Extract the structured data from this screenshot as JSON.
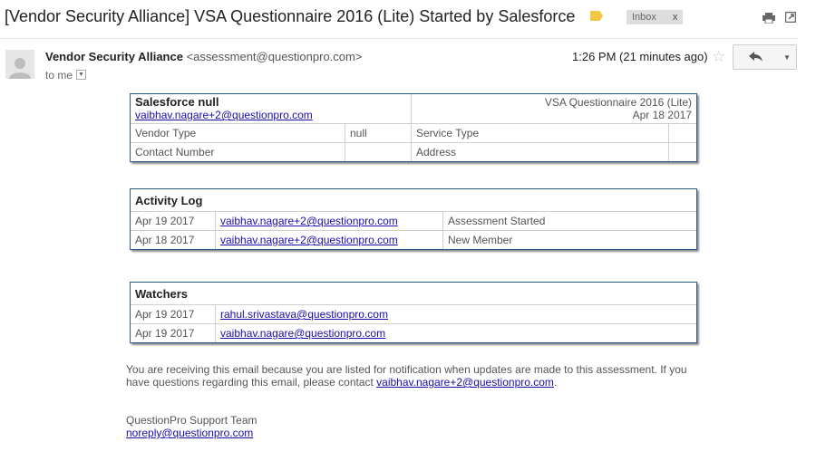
{
  "subject": "[Vendor Security Alliance] VSA Questionnaire 2016 (Lite) Started by Salesforce",
  "inbox_label": "Inbox",
  "inbox_close": "x",
  "sender": {
    "name": "Vendor Security Alliance",
    "email": "<assessment@questionpro.com>",
    "to": "to me",
    "time": "1:26 PM (21 minutes ago)"
  },
  "summary": {
    "org": "Salesforce null",
    "org_email": "vaibhav.nagare+2@questionpro.com",
    "survey": "VSA Questionnaire 2016 (Lite)",
    "date": "Apr 18 2017",
    "vendor_type_label": "Vendor Type",
    "vendor_type_value": "null",
    "service_type_label": "Service Type",
    "service_type_value": "",
    "contact_label": "Contact Number",
    "contact_value": "",
    "address_label": "Address",
    "address_value": ""
  },
  "activity": {
    "title": "Activity Log",
    "rows": [
      {
        "date": "Apr 19 2017",
        "email": "vaibhav.nagare+2@questionpro.com",
        "action": "Assessment Started"
      },
      {
        "date": "Apr 18 2017",
        "email": "vaibhav.nagare+2@questionpro.com",
        "action": "New Member"
      }
    ]
  },
  "watchers": {
    "title": "Watchers",
    "rows": [
      {
        "date": "Apr 19 2017",
        "email": "rahul.srivastava@questionpro.com"
      },
      {
        "date": "Apr 19 2017",
        "email": "vaibhav.nagare@questionpro.com"
      }
    ]
  },
  "footer": {
    "notice_1": "You are receiving this email because you are listed for notification when updates are made to this assessment. If you",
    "notice_2": "have questions regarding this email, please contact ",
    "contact_email": "vaibhav.nagare+2@questionpro.com",
    "period": ".",
    "team": "QuestionPro Support Team",
    "team_email": "noreply@questionpro.com"
  },
  "icons": {
    "label": "label-tag-icon",
    "print": "print-icon",
    "new_window": "new-window-icon",
    "star": "star-icon",
    "reply": "reply-icon",
    "more": "chevron-down-icon",
    "avatar": "person-icon"
  },
  "colors": {
    "label_tag": "#f2c744",
    "box_border": "#2a5a8c",
    "link": "#1a0dab"
  }
}
